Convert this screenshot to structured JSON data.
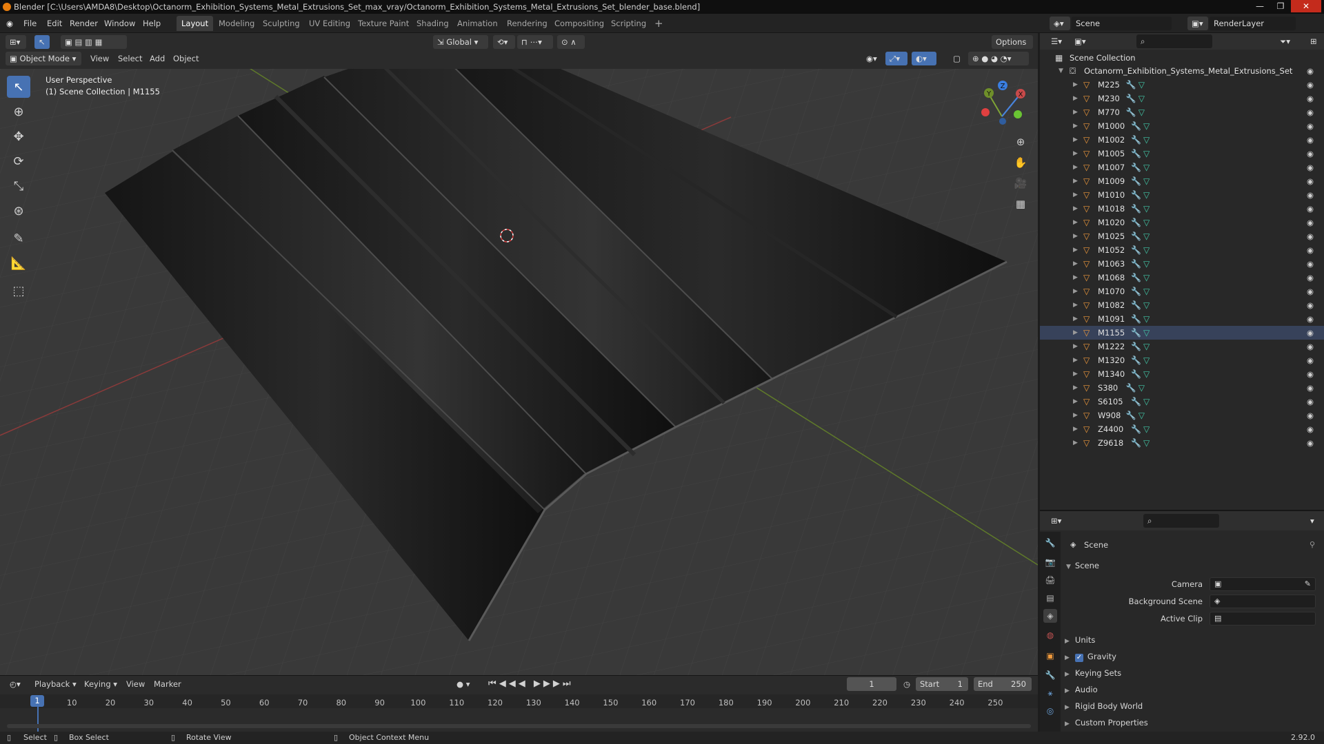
{
  "titlebar": {
    "text": "Blender [C:\\Users\\AMDA8\\Desktop\\Octanorm_Exhibition_Systems_Metal_Extrusions_Set_max_vray/Octanorm_Exhibition_Systems_Metal_Extrusions_Set_blender_base.blend]"
  },
  "menu": [
    "File",
    "Edit",
    "Render",
    "Window",
    "Help"
  ],
  "workspaces": [
    "Layout",
    "Modeling",
    "Sculpting",
    "UV Editing",
    "Texture Paint",
    "Shading",
    "Animation",
    "Rendering",
    "Compositing",
    "Scripting"
  ],
  "active_workspace": "Layout",
  "scene_field": "Scene",
  "renderlayer_field": "RenderLayer",
  "viewport_header": {
    "orientation": "Global",
    "options": "Options",
    "mode": "Object Mode",
    "menus": [
      "View",
      "Select",
      "Add",
      "Object"
    ]
  },
  "viewport": {
    "perspective": "User Perspective",
    "collection_info": "(1) Scene Collection | M1155"
  },
  "gizmo": {
    "x": "X",
    "y": "Y",
    "z": "Z"
  },
  "outliner": {
    "root": "Scene Collection",
    "collection": "Octanorm_Exhibition_Systems_Metal_Extrusions_Set",
    "objects": [
      "M225",
      "M230",
      "M770",
      "M1000",
      "M1002",
      "M1005",
      "M1007",
      "M1009",
      "M1010",
      "M1018",
      "M1020",
      "M1025",
      "M1052",
      "M1063",
      "M1068",
      "M1070",
      "M1082",
      "M1091",
      "M1155",
      "M1222",
      "M1320",
      "M1340",
      "S380",
      "S6105",
      "W908",
      "Z4400",
      "Z9618"
    ],
    "selected": "M1155"
  },
  "properties": {
    "context": "Scene",
    "panel": "Scene",
    "fields": {
      "camera": "Camera",
      "background_scene": "Background Scene",
      "active_clip": "Active Clip"
    },
    "sections": [
      "Units",
      "Gravity",
      "Keying Sets",
      "Audio",
      "Rigid Body World",
      "Custom Properties"
    ],
    "gravity_enabled": true
  },
  "timeline": {
    "menus": [
      "Playback",
      "Keying",
      "View",
      "Marker"
    ],
    "current_frame": "1",
    "start_label": "Start",
    "start": "1",
    "end_label": "End",
    "end": "250",
    "ticks": [
      "1",
      "10",
      "20",
      "30",
      "40",
      "50",
      "60",
      "70",
      "80",
      "90",
      "100",
      "110",
      "120",
      "130",
      "140",
      "150",
      "160",
      "170",
      "180",
      "190",
      "200",
      "210",
      "220",
      "230",
      "240",
      "250"
    ]
  },
  "statusbar": {
    "select": "Select",
    "box_select": "Box Select",
    "rotate": "Rotate View",
    "context_menu": "Object Context Menu",
    "version": "2.92.0"
  },
  "colors": {
    "accent": "#4772b3",
    "object": "#f09a3c",
    "mesh": "#42c9a8",
    "axis_x": "#c84a4a",
    "axis_y": "#8ab33a"
  }
}
